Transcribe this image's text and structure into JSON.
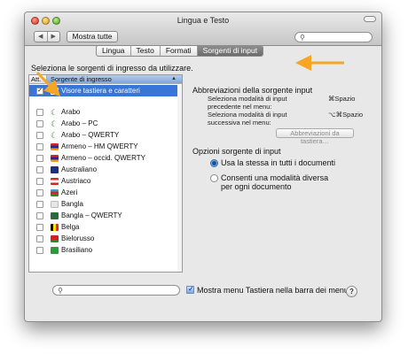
{
  "window": {
    "title": "Lingua e Testo"
  },
  "toolbar": {
    "back_label": "◀",
    "forward_label": "▶",
    "show_all_label": "Mostra tutte",
    "search_placeholder": ""
  },
  "tabs": [
    {
      "label": "Lingua",
      "active": false
    },
    {
      "label": "Testo",
      "active": false
    },
    {
      "label": "Formati",
      "active": false
    },
    {
      "label": "Sorgenti di input",
      "active": true
    }
  ],
  "instruction": "Seleziona le sorgenti di ingresso da utilizzare.",
  "list": {
    "col_att": "Att.",
    "col_source": "Sorgente di ingresso",
    "sort_glyph": "▲",
    "rows": [
      {
        "label": "Visore tastiera e caratteri",
        "checked": true,
        "selected": true,
        "icon": "keyboard-icon"
      },
      {
        "label": "Arabo",
        "checked": false,
        "icon": "crescent-icon"
      },
      {
        "label": "Arabo – PC",
        "checked": false,
        "icon": "crescent-icon"
      },
      {
        "label": "Arabo – QWERTY",
        "checked": false,
        "icon": "crescent-icon"
      },
      {
        "label": "Armeno – HM QWERTY",
        "checked": false,
        "icon": "flag-armenia-icon"
      },
      {
        "label": "Armeno – occid. QWERTY",
        "checked": false,
        "icon": "flag-armenia-icon"
      },
      {
        "label": "Australiano",
        "checked": false,
        "icon": "flag-australia-icon"
      },
      {
        "label": "Austriaco",
        "checked": false,
        "icon": "flag-austria-icon"
      },
      {
        "label": "Azeri",
        "checked": false,
        "icon": "flag-azerbaijan-icon"
      },
      {
        "label": "Bangla",
        "checked": false,
        "icon": "bangla-script-icon"
      },
      {
        "label": "Bangla – QWERTY",
        "checked": false,
        "icon": "flag-bangladesh-icon"
      },
      {
        "label": "Belga",
        "checked": false,
        "icon": "flag-belgium-icon"
      },
      {
        "label": "Bielorusso",
        "checked": false,
        "icon": "flag-belarus-icon"
      },
      {
        "label": "Brasiliano",
        "checked": false,
        "icon": "flag-brazil-icon"
      }
    ]
  },
  "shortcuts": {
    "title": "Abbreviazioni della sorgente input",
    "prev_label": "Seleziona modalità di input precedente nel menu:",
    "prev_key": "⌘Spazio",
    "next_label": "Seleziona modalità di input successiva nel menu:",
    "next_key": "⌥⌘Spazio",
    "button_label": "Abbreviazioni da tastiera…"
  },
  "options": {
    "title": "Opzioni sorgente di input",
    "radio_same": "Usa la stessa in tutti i documenti",
    "radio_diff_line1": "Consenti una modalità diversa",
    "radio_diff_line2": "per ogni documento"
  },
  "bottom": {
    "search_placeholder": "",
    "show_menu_label": "Mostra menu Tastiera nella barra dei menu",
    "help_label": "?"
  },
  "colors": {
    "selection": "#3875d7",
    "annotation_arrow": "#f5a623",
    "active_tab": "#7b7b7b"
  }
}
